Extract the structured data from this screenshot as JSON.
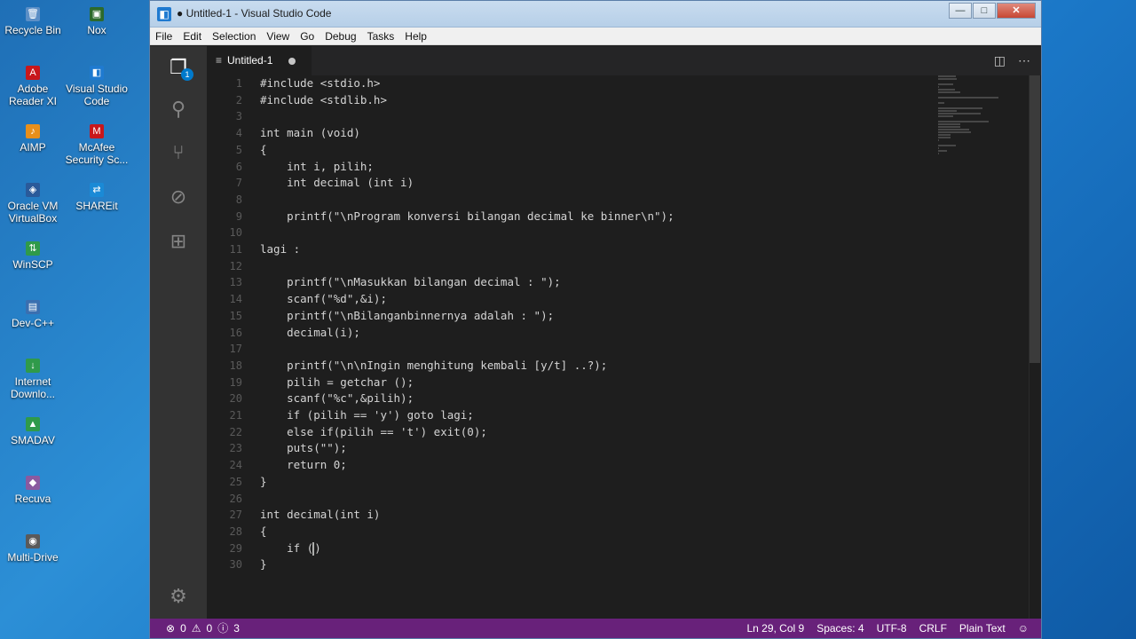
{
  "desktop": {
    "icons": [
      {
        "label": "Recycle Bin",
        "glyph": "🗑",
        "color": "#5c8fc6"
      },
      {
        "label": "Nox",
        "glyph": "▣",
        "color": "#2c6a2c"
      },
      {
        "label": "Adobe Reader XI",
        "glyph": "A",
        "color": "#c8171b"
      },
      {
        "label": "Visual Studio Code",
        "glyph": "◧",
        "color": "#1f7ad0"
      },
      {
        "label": "AIMP",
        "glyph": "♪",
        "color": "#e88f1b"
      },
      {
        "label": "McAfee Security Sc...",
        "glyph": "M",
        "color": "#c8171b"
      },
      {
        "label": "Oracle VM VirtualBox",
        "glyph": "◈",
        "color": "#2a5a9a"
      },
      {
        "label": "SHAREit",
        "glyph": "⇄",
        "color": "#1a8ad6"
      },
      {
        "label": "WinSCP",
        "glyph": "⇅",
        "color": "#2f9a4a"
      },
      {
        "label": "Dev-C++",
        "glyph": "▤",
        "color": "#3a6fb0"
      },
      {
        "label": "Internet Downlo...",
        "glyph": "↓",
        "color": "#2f9a4a"
      },
      {
        "label": "SMADAV",
        "glyph": "▲",
        "color": "#2f9a4a"
      },
      {
        "label": "Recuva",
        "glyph": "◆",
        "color": "#8a5aa0"
      },
      {
        "label": "Multi-Drive",
        "glyph": "◉",
        "color": "#5a5a5a"
      }
    ]
  },
  "window": {
    "title": "● Untitled-1 - Visual Studio Code",
    "controls": {
      "minimize": "—",
      "maximize": "□",
      "close": "✕"
    }
  },
  "menu": [
    "File",
    "Edit",
    "Selection",
    "View",
    "Go",
    "Debug",
    "Tasks",
    "Help"
  ],
  "activity": {
    "explorer_badge": "1"
  },
  "tab": {
    "name": "Untitled-1",
    "icon": "≡"
  },
  "code": [
    {
      "n": "1",
      "t": "#include <stdio.h>"
    },
    {
      "n": "2",
      "t": "#include <stdlib.h>"
    },
    {
      "n": "3",
      "t": ""
    },
    {
      "n": "4",
      "t": "int main (void)"
    },
    {
      "n": "5",
      "t": "{"
    },
    {
      "n": "6",
      "t": "    int i, pilih;"
    },
    {
      "n": "7",
      "t": "    int decimal (int i)"
    },
    {
      "n": "8",
      "t": ""
    },
    {
      "n": "9",
      "t": "    printf(\"\\nProgram konversi bilangan decimal ke binner\\n\");"
    },
    {
      "n": "10",
      "t": ""
    },
    {
      "n": "11",
      "t": "lagi :"
    },
    {
      "n": "12",
      "t": ""
    },
    {
      "n": "13",
      "t": "    printf(\"\\nMasukkan bilangan decimal : \");"
    },
    {
      "n": "14",
      "t": "    scanf(\"%d\",&i);"
    },
    {
      "n": "15",
      "t": "    printf(\"\\nBilanganbinnernya adalah : \");"
    },
    {
      "n": "16",
      "t": "    decimal(i);"
    },
    {
      "n": "17",
      "t": ""
    },
    {
      "n": "18",
      "t": "    printf(\"\\n\\nIngin menghitung kembali [y/t] ..?);"
    },
    {
      "n": "19",
      "t": "    pilih = getchar ();"
    },
    {
      "n": "20",
      "t": "    scanf(\"%c\",&pilih);"
    },
    {
      "n": "21",
      "t": "    if (pilih == 'y') goto lagi;"
    },
    {
      "n": "22",
      "t": "    else if(pilih == 't') exit(0);"
    },
    {
      "n": "23",
      "t": "    puts(\"\");"
    },
    {
      "n": "24",
      "t": "    return 0;"
    },
    {
      "n": "25",
      "t": "}"
    },
    {
      "n": "26",
      "t": ""
    },
    {
      "n": "27",
      "t": "int decimal(int i)"
    },
    {
      "n": "28",
      "t": "{"
    },
    {
      "n": "29",
      "t": "    if ()"
    },
    {
      "n": "30",
      "t": "}"
    }
  ],
  "status": {
    "errors": "0",
    "warnings": "0",
    "info": "3",
    "position": "Ln 29, Col 9",
    "spaces": "Spaces: 4",
    "encoding": "UTF-8",
    "eol": "CRLF",
    "language": "Plain Text",
    "feedback_icon": "☺"
  },
  "colors": {
    "statusbar": "#68217a",
    "accent": "#007acc"
  }
}
